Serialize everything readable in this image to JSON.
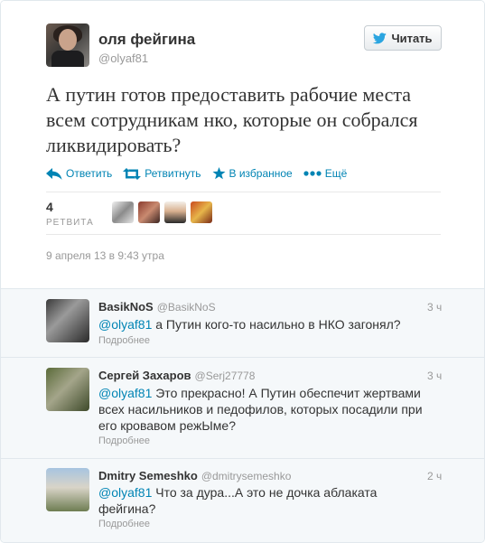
{
  "tweet": {
    "author": {
      "name": "оля фейгина",
      "handle": "@olyaf81"
    },
    "follow_button": {
      "label": "Читать"
    },
    "text": "А путин готов предоставить рабочие места всем сотрудникам нко, которые он собрался ликвидировать?",
    "actions": [
      {
        "label": "Ответить",
        "icon": "reply-icon"
      },
      {
        "label": "Ретвитнуть",
        "icon": "retweet-icon"
      },
      {
        "label": "В избранное",
        "icon": "star-icon"
      },
      {
        "label": "Ещё",
        "icon": "more-dots-icon"
      }
    ],
    "retweets": {
      "count": "4",
      "label": "РЕТВИТА"
    },
    "timestamp": "9 апреля 13 в 9:43 утра"
  },
  "replies": [
    {
      "name": "BasikNoS",
      "handle": "@BasikNoS",
      "time": "3 ч",
      "mention": "@olyaf81",
      "text": " а Путин кого-то насильно в НКО загонял?",
      "more": "Подробнее"
    },
    {
      "name": "Сергей Захаров",
      "handle": "@Serj27778",
      "time": "3 ч",
      "mention": "@olyaf81",
      "text": " Это прекрасно! А Путин обеспечит жертвами всех насильников и педофилов, которых посадили при его кровавом режЫме?",
      "more": "Подробнее"
    },
    {
      "name": "Dmitry Semeshko",
      "handle": "@dmitrysemeshko",
      "time": "2 ч",
      "mention": "@olyaf81",
      "text": " Что за дура...А это не дочка аблаката фейгина?",
      "more": "Подробнее"
    }
  ],
  "colors": {
    "link": "#0084b4",
    "muted": "#999999",
    "text": "#333333",
    "reply_bg": "#f5f8fa"
  }
}
